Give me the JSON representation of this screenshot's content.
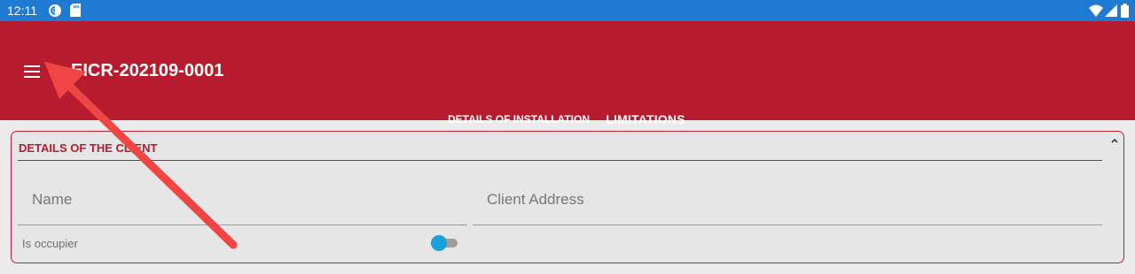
{
  "status_bar": {
    "time": "12:11",
    "icons": [
      "pocket-casts-icon",
      "sd-card-icon",
      "wifi-icon",
      "signal-icon",
      "battery-icon"
    ]
  },
  "app_bar": {
    "title": "EICR-202109-0001",
    "menu_icon": "hamburger-menu-icon",
    "tabs": [
      {
        "label": "DETAILS OF INSTALLATION",
        "selected": true
      },
      {
        "label": "LIMITATIONS",
        "selected": false
      }
    ]
  },
  "client_section": {
    "title": "DETAILS OF THE CLIENT",
    "collapse_icon": "chevron-up-icon",
    "name_field": {
      "placeholder": "Name",
      "value": ""
    },
    "address_field": {
      "placeholder": "Client Address",
      "value": ""
    },
    "is_occupier": {
      "label": "Is occupier",
      "checked": false
    }
  },
  "colors": {
    "status_bar": "#1e7ad3",
    "app_bar": "#b71c2e",
    "accent": "#1a9fd9",
    "annotation_arrow": "#f04545"
  }
}
